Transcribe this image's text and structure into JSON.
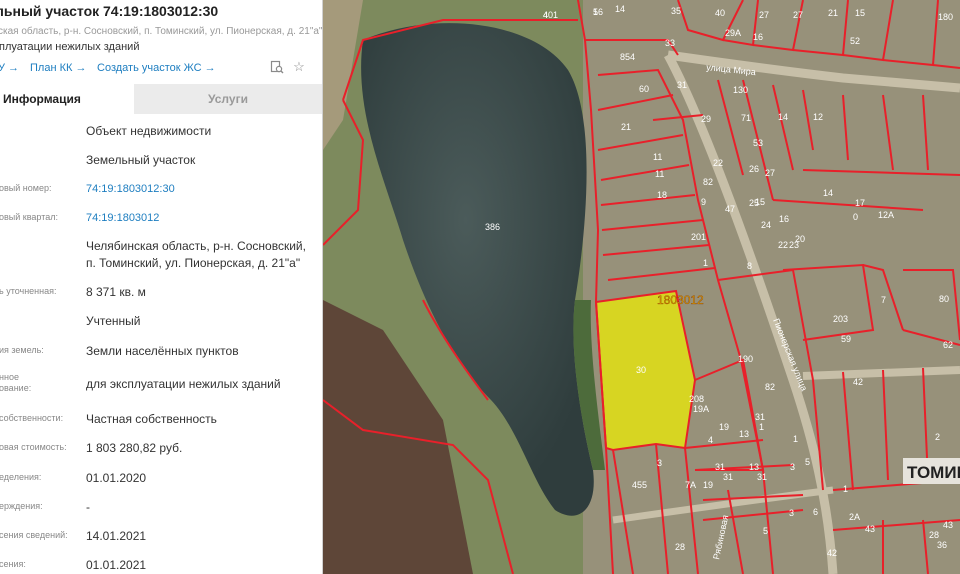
{
  "panel": {
    "title": "льный участок 74:19:1803012:30",
    "address": "ская область, р-н. Сосновский, п. Томинский, ул. Пионерская, д. 21\"а\"",
    "purpose": "плуатации нежилых зданий",
    "links": {
      "first": "У →",
      "plan": "План КК →",
      "create": "Создать участок ЖС →"
    },
    "tabs": {
      "info": "Информация",
      "services": "Услуги"
    },
    "rows": [
      {
        "label": "",
        "value": "Объект недвижимости"
      },
      {
        "label": "",
        "value": "Земельный участок"
      },
      {
        "label": "овый номер:",
        "value": "74:19:1803012:30"
      },
      {
        "label": "овый квартал:",
        "value": "74:19:1803012"
      },
      {
        "label": "",
        "value": "Челябинская область, р-н. Сосновский,",
        "value2": "п. Томинский, ул. Пионерская, д. 21\"а\""
      },
      {
        "label": "ь уточненная:",
        "value": "8 371 кв. м"
      },
      {
        "label": "",
        "value": "Учтенный"
      },
      {
        "label": "ия земель:",
        "value": "Земли населённых пунктов"
      },
      {
        "label": "нное",
        "label2": "ование:",
        "value": "для эксплуатации нежилых зданий"
      },
      {
        "label": "собственности:",
        "value": "Частная собственность"
      },
      {
        "label": "овая стоимость:",
        "value": "1 803 280,82 руб."
      },
      {
        "label": "еделения:",
        "value": "01.01.2020"
      },
      {
        "label": "ерждения:",
        "value": "-"
      },
      {
        "label": "сения сведений:",
        "value": "14.01.2021"
      },
      {
        "label": "сения:",
        "value": "01.01.2021"
      }
    ]
  },
  "map": {
    "street_mira": "улица Мира",
    "street_pionerskaya": "Пионерская улица",
    "street_ryabinovaya": "Рябиновая",
    "quarter": "1803012",
    "town": "ТОМИН",
    "plot_label": "30",
    "lake_label": "386",
    "parcels": [
      "401",
      "16",
      "14",
      "35",
      "40",
      "27",
      "29А",
      "16",
      "27",
      "21",
      "52",
      "15",
      "180",
      "854",
      "33",
      "60",
      "31",
      "11",
      "130",
      "14",
      "12",
      "21",
      "29",
      "71",
      "53",
      "11",
      "18",
      "22",
      "27",
      "26",
      "82",
      "15",
      "47",
      "25",
      "9",
      "24",
      "16",
      "14",
      "17",
      "0",
      "12А",
      "201",
      "1",
      "8",
      "20",
      "23",
      "22",
      "7",
      "80",
      "190",
      "203",
      "59",
      "62",
      "82",
      "208",
      "19А",
      "19",
      "1",
      "42",
      "31",
      "1",
      "4",
      "13",
      "2",
      "3",
      "13",
      "455",
      "3",
      "5",
      "31",
      "19",
      "7А",
      "31",
      "31",
      "28",
      "5",
      "3",
      "2А",
      "43",
      "28",
      "43",
      "36",
      "42",
      "6",
      "1",
      "4",
      "5"
    ],
    "colors": {
      "boundary": "#e8202a",
      "selected": "#f0f000",
      "label_selected": "#e0a800"
    }
  }
}
